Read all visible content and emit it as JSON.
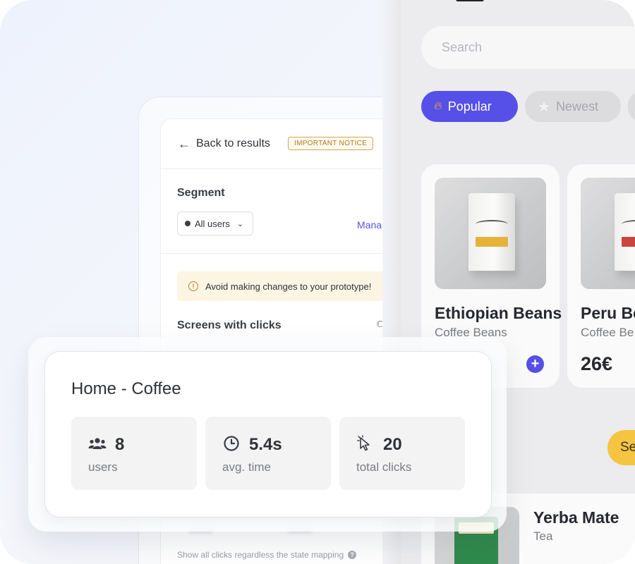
{
  "analytics": {
    "back_label": "Back to results",
    "notice_badge": "IMPORTANT NOTICE",
    "segment_title": "Segment",
    "segment_value": "All users",
    "manage_link": "Mana",
    "warning_text": "Avoid making changes to your prototype!",
    "screens_title": "Screens with clicks",
    "show_all_text": "Show all clicks regardless the state mapping"
  },
  "stats": {
    "title": "Home - Coffee",
    "items": [
      {
        "value": "8",
        "label": "users",
        "icon": "users-icon"
      },
      {
        "value": "5.4s",
        "label": "avg. time",
        "icon": "clock-icon"
      },
      {
        "value": "20",
        "label": "total clicks",
        "icon": "cursor-click-icon"
      }
    ]
  },
  "app": {
    "search_placeholder": "Search",
    "chips": [
      {
        "label": "Popular",
        "icon": "flame-icon",
        "active": true
      },
      {
        "label": "Newest",
        "icon": "star-icon",
        "active": false
      }
    ],
    "products": [
      {
        "name": "Ethiopian Beans",
        "category": "Coffee Beans",
        "price": "",
        "has_add": true
      },
      {
        "name": "Peru Be",
        "category": "Coffee Be",
        "price": "26€",
        "has_add": false
      }
    ],
    "yellow_button": "Se",
    "list_item": {
      "name": "Yerba Mate",
      "category": "Tea"
    }
  },
  "colors": {
    "accent": "#5650e8",
    "notice": "#b27917",
    "yellow": "#f5c542"
  }
}
